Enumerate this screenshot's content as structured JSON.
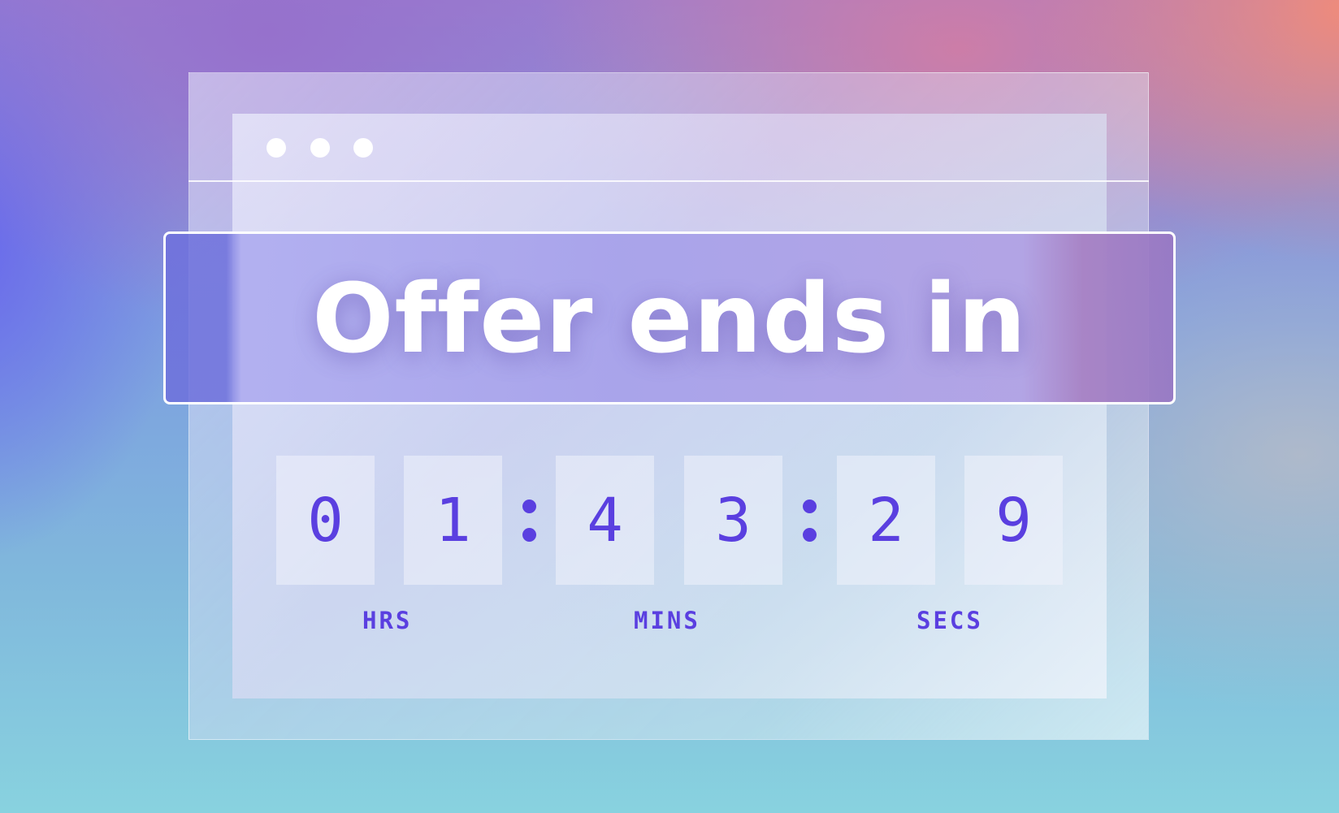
{
  "banner": {
    "title": "Offer ends in"
  },
  "countdown": {
    "hours": [
      "0",
      "1"
    ],
    "minutes": [
      "4",
      "3"
    ],
    "seconds": [
      "2",
      "9"
    ],
    "separator": ":"
  },
  "labels": {
    "hours": "HRS",
    "minutes": "MINS",
    "seconds": "SECS"
  },
  "colors": {
    "accent": "#5a3fe0",
    "banner_text": "#ffffff",
    "background_top_right": "#f08c76",
    "background_left": "#6868ec",
    "background_bottom": "#88d2df"
  },
  "icons": {
    "window_controls": [
      "window-dot-icon",
      "window-dot-icon",
      "window-dot-icon"
    ]
  }
}
